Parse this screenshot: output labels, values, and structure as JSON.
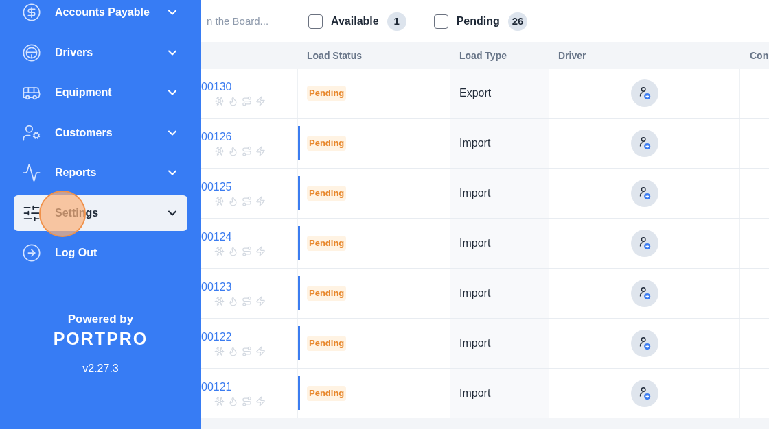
{
  "sidebar": {
    "items": [
      {
        "label": "Accounts Payable",
        "kind": "dollar",
        "selected": false,
        "expandable": true
      },
      {
        "label": "Drivers",
        "kind": "wheel",
        "selected": false,
        "expandable": true
      },
      {
        "label": "Equipment",
        "kind": "bus",
        "selected": false,
        "expandable": true
      },
      {
        "label": "Customers",
        "kind": "customer",
        "selected": false,
        "expandable": true
      },
      {
        "label": "Reports",
        "kind": "activity",
        "selected": false,
        "expandable": true
      },
      {
        "label": "Settings",
        "kind": "sliders",
        "selected": true,
        "expandable": true
      },
      {
        "label": "Log Out",
        "kind": "logout",
        "selected": false,
        "expandable": false
      }
    ],
    "powered_by": "Powered by",
    "logo": "PORTPRO",
    "version": "v2.27.3"
  },
  "search": {
    "placeholder": "n the Board..."
  },
  "filters": [
    {
      "label": "Available",
      "count": "1",
      "checked": false
    },
    {
      "label": "Pending",
      "count": "26",
      "checked": false
    }
  ],
  "table": {
    "columns": [
      "Load Status",
      "Load Type",
      "Driver",
      "Con"
    ],
    "rows": [
      {
        "load": "00130",
        "status": "Pending",
        "type": "Export",
        "marked": false
      },
      {
        "load": "00126",
        "status": "Pending",
        "type": "Import",
        "marked": true
      },
      {
        "load": "00125",
        "status": "Pending",
        "type": "Import",
        "marked": true
      },
      {
        "load": "00124",
        "status": "Pending",
        "type": "Import",
        "marked": true
      },
      {
        "load": "00123",
        "status": "Pending",
        "type": "Import",
        "marked": true
      },
      {
        "load": "00122",
        "status": "Pending",
        "type": "Import",
        "marked": true
      },
      {
        "load": "00121",
        "status": "Pending",
        "type": "Import",
        "marked": true
      }
    ]
  }
}
